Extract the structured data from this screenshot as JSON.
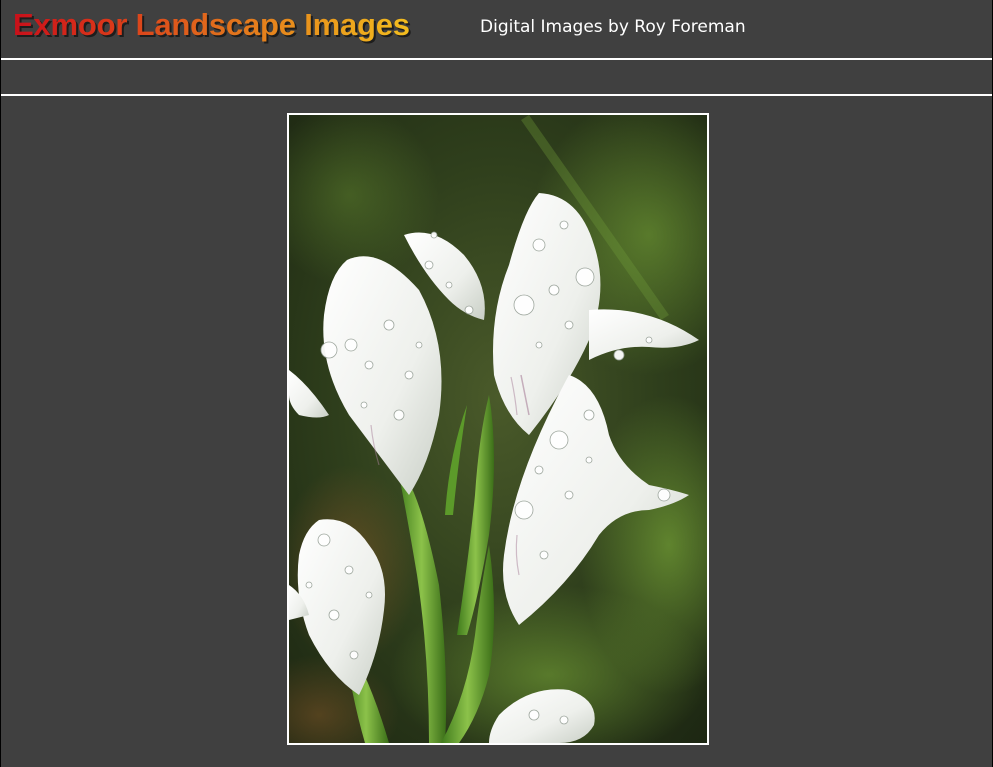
{
  "header": {
    "site_title": "Exmoor Landscape Images",
    "subtitle": "Digital Images by Roy Foreman"
  },
  "nav": {
    "items": []
  },
  "photo": {
    "subject": "white-iris-flower-with-raindrops",
    "frame_color": "#ffffff"
  },
  "colors": {
    "page_background": "#404040",
    "title_gradient_start": "#c8101a",
    "title_gradient_end": "#f3bd1e",
    "rule": "#ffffff"
  }
}
